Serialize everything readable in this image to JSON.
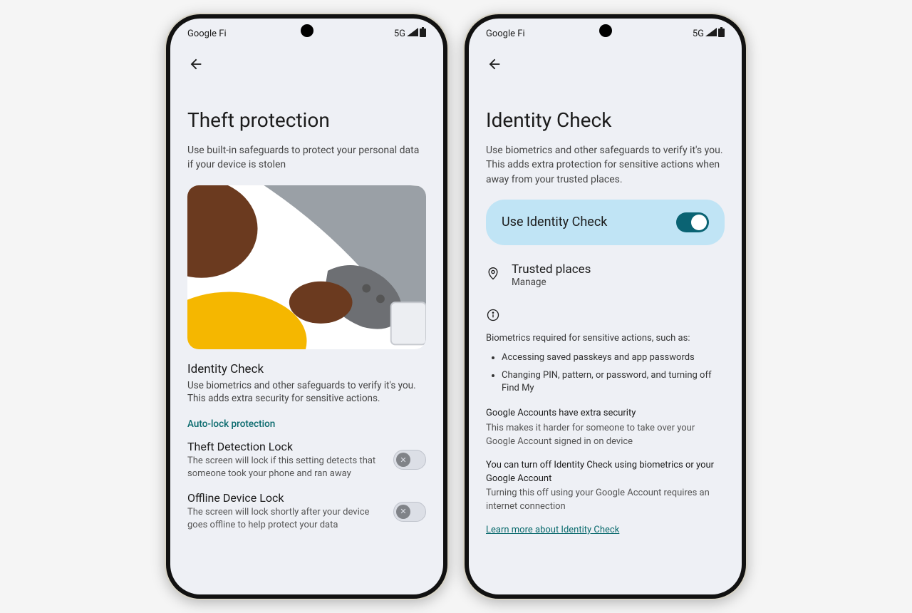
{
  "status": {
    "carrier": "Google Fi",
    "network": "5G"
  },
  "phone1": {
    "title": "Theft protection",
    "subtitle": "Use built-in safeguards to protect your personal data if your device is stolen",
    "section": {
      "title": "Identity Check",
      "desc": "Use biometrics and other safeguards to verify it's you. This adds extra security for sensitive actions."
    },
    "category": "Auto-lock protection",
    "settings": [
      {
        "title": "Theft Detection Lock",
        "sub": "The screen will lock if this setting detects that someone took your phone and ran away",
        "on": false
      },
      {
        "title": "Offline Device Lock",
        "sub": "The screen will lock shortly after your device goes offline to help protect your data",
        "on": false
      }
    ]
  },
  "phone2": {
    "title": "Identity Check",
    "subtitle": "Use biometrics and other safeguards to verify it's you. This adds extra protection for sensitive actions when away from your trusted places.",
    "toggle": {
      "label": "Use Identity Check",
      "on": true
    },
    "trusted": {
      "title": "Trusted places",
      "sub": "Manage"
    },
    "info_header": "Biometrics required for sensitive actions, such as:",
    "bullets": [
      "Accessing saved passkeys and app passwords",
      "Changing PIN, pattern, or password, and turning off Find My"
    ],
    "paras": [
      {
        "title": "Google Accounts have extra security",
        "body": "This makes it harder for someone to take over your Google Account signed in on device"
      },
      {
        "title": "You can turn off Identity Check using biometrics or your Google Account",
        "body": "Turning this off using your Google Account requires an internet connection"
      }
    ],
    "link": "Learn more about Identity Check"
  }
}
